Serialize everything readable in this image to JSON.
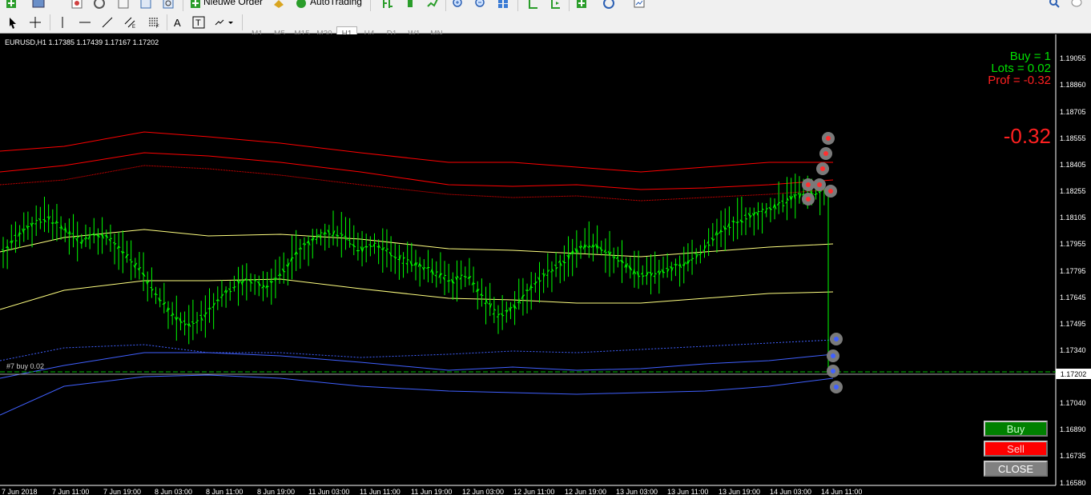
{
  "toolbar": {
    "new_order_label": "Nieuwe Order",
    "autotrading_label": "AutoTrading",
    "timeframes": [
      "M1",
      "M5",
      "M15",
      "M30",
      "H1",
      "H4",
      "D1",
      "W1",
      "MN"
    ],
    "active_timeframe": "H1"
  },
  "chart": {
    "symbol_info": "EURUSD,H1  1.17385 1.17439 1.17167 1.17202",
    "stats": {
      "buy": "Buy = 1",
      "lots": "Lots = 0.02",
      "profit": "Prof = -0.32"
    },
    "big_profit": "-0.32",
    "order_line_label": "#7 buy 0.02",
    "current_price": "1.17202",
    "price_axis": [
      "1.19055",
      "1.18860",
      "1.18705",
      "1.18555",
      "1.18405",
      "1.18255",
      "1.18105",
      "1.17955",
      "1.17795",
      "1.17645",
      "1.17495",
      "1.17340",
      "1.17040",
      "1.16890",
      "1.16735",
      "1.16580"
    ],
    "time_axis": [
      "7 Jun 2018",
      "7 Jun 11:00",
      "7 Jun 19:00",
      "8 Jun 03:00",
      "8 Jun 11:00",
      "8 Jun 19:00",
      "11 Jun 03:00",
      "11 Jun 11:00",
      "11 Jun 19:00",
      "12 Jun 03:00",
      "12 Jun 11:00",
      "12 Jun 19:00",
      "13 Jun 03:00",
      "13 Jun 11:00",
      "13 Jun 19:00",
      "14 Jun 03:00",
      "14 Jun 11:00"
    ],
    "buttons": {
      "buy": "Buy",
      "sell": "Sell",
      "close": "CLOSE"
    },
    "colors": {
      "background": "#000000",
      "candles": "#00ff00",
      "upper_band": "#ff0000",
      "middle_band": "#ffff80",
      "lower_band": "#4060ff"
    }
  }
}
